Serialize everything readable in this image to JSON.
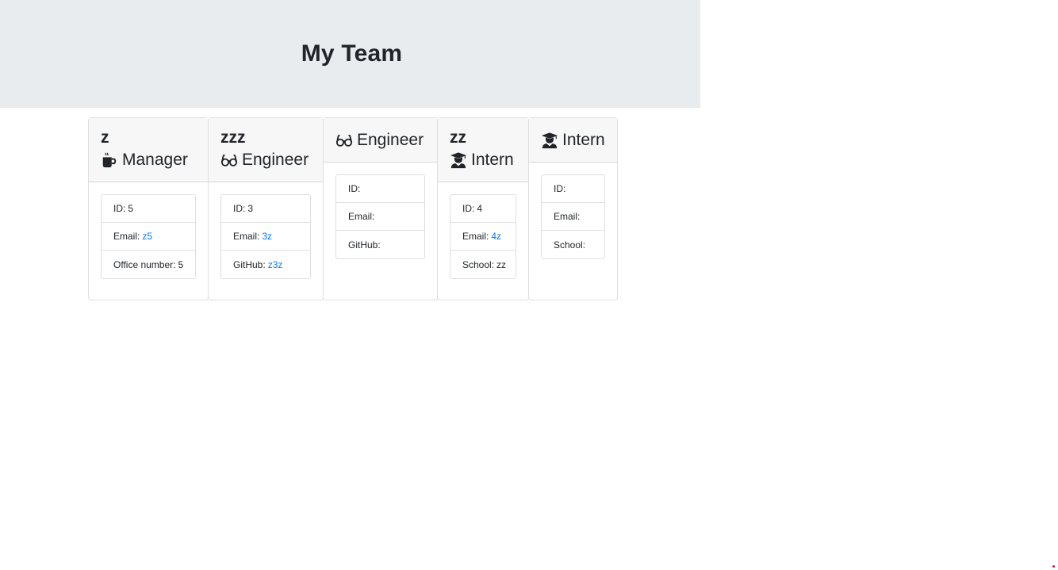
{
  "header": {
    "title": "My Team"
  },
  "cards": [
    {
      "name": "z",
      "role": "Manager",
      "icon": "mug-icon",
      "fields": [
        {
          "label": "ID:",
          "value": "5",
          "link": false
        },
        {
          "label": "Email:",
          "value": "z5",
          "link": true
        },
        {
          "label": "Office number:",
          "value": "5",
          "link": false
        }
      ]
    },
    {
      "name": "zzz",
      "role": "Engineer",
      "icon": "glasses-icon",
      "fields": [
        {
          "label": "ID:",
          "value": "3",
          "link": false
        },
        {
          "label": "Email:",
          "value": "3z",
          "link": true
        },
        {
          "label": "GitHub:",
          "value": "z3z",
          "link": true
        }
      ]
    },
    {
      "name": "",
      "role": "Engineer",
      "icon": "glasses-icon",
      "fields": [
        {
          "label": "ID:",
          "value": "",
          "link": false
        },
        {
          "label": "Email:",
          "value": "",
          "link": true
        },
        {
          "label": "GitHub:",
          "value": "",
          "link": true
        }
      ]
    },
    {
      "name": "zz",
      "role": "Intern",
      "icon": "graduate-icon",
      "fields": [
        {
          "label": "ID:",
          "value": "4",
          "link": false
        },
        {
          "label": "Email:",
          "value": "4z",
          "link": true
        },
        {
          "label": "School:",
          "value": "zz",
          "link": false
        }
      ]
    },
    {
      "name": "",
      "role": "Intern",
      "icon": "graduate-icon",
      "fields": [
        {
          "label": "ID:",
          "value": "",
          "link": false
        },
        {
          "label": "Email:",
          "value": "",
          "link": true
        },
        {
          "label": "School:",
          "value": "",
          "link": false
        }
      ]
    }
  ],
  "colors": {
    "header_bg": "#e9ecef",
    "card_header_bg": "#f7f7f7",
    "link": "#007bff"
  }
}
